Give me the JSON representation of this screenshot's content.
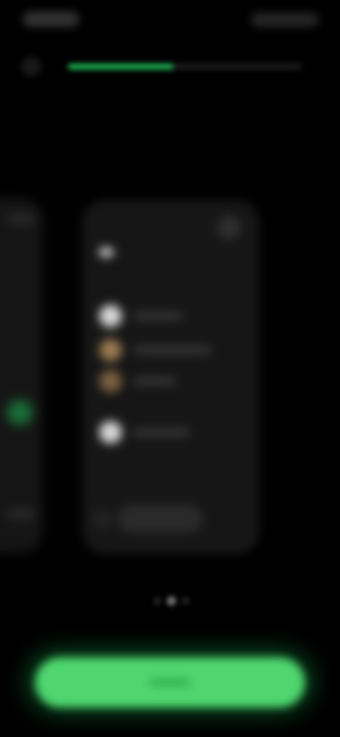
{
  "colors": {
    "background": "#000000",
    "accent": "#1db954",
    "cta": "#4fd66f",
    "card": "#161616"
  },
  "status_bar": {
    "time": "",
    "icons": [
      "signal-icon",
      "wifi-icon",
      "battery-icon"
    ]
  },
  "header": {
    "progress_fraction": 0.45
  },
  "title": "",
  "subtitle": "",
  "carousel": {
    "active_index": 1,
    "page_count": 3,
    "main_card": {
      "badge": "",
      "features": [
        {
          "icon": "circle-icon",
          "color": "#d9d9d9"
        },
        {
          "icon": "circle-icon",
          "color": "#9a7a50"
        },
        {
          "icon": "circle-icon",
          "color": "#7a6040"
        },
        {
          "icon": "circle-icon",
          "color": "#d9d9d9"
        }
      ],
      "cta": ""
    }
  },
  "primary_button": {
    "label": ""
  }
}
